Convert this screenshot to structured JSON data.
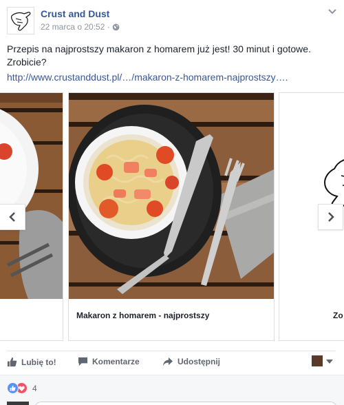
{
  "post": {
    "page_name": "Crust and Dust",
    "timestamp": "22 marca o 20:52 ·",
    "privacy_icon": "globe-icon",
    "text": "Przepis na najprostszy makaron z homarem już jest! 30 minut i gotowe. Zrobicie?",
    "link": "http://www.crustanddust.pl/…/makaron-z-homarem-najprostszy…."
  },
  "carousel": {
    "cards": [
      {
        "caption": "",
        "image": "pasta-plate-partial"
      },
      {
        "caption": "Makaron z homarem - najprostszy",
        "image": "lobster-pasta-bowl"
      },
      {
        "caption": "Zo",
        "image": "crust-and-dust-logo"
      }
    ],
    "prev_icon": "chevron-left-icon",
    "next_icon": "chevron-right-icon"
  },
  "actions": {
    "like_label": "Lubię to!",
    "comment_label": "Komentarze",
    "share_label": "Udostępnij"
  },
  "reactions": {
    "count": "4",
    "types": [
      "like",
      "love"
    ]
  },
  "colors": {
    "link_blue": "#365899",
    "text": "#1d2129",
    "meta_gray": "#90949c",
    "like_blue": "#5890ff",
    "love_red": "#f25268"
  }
}
